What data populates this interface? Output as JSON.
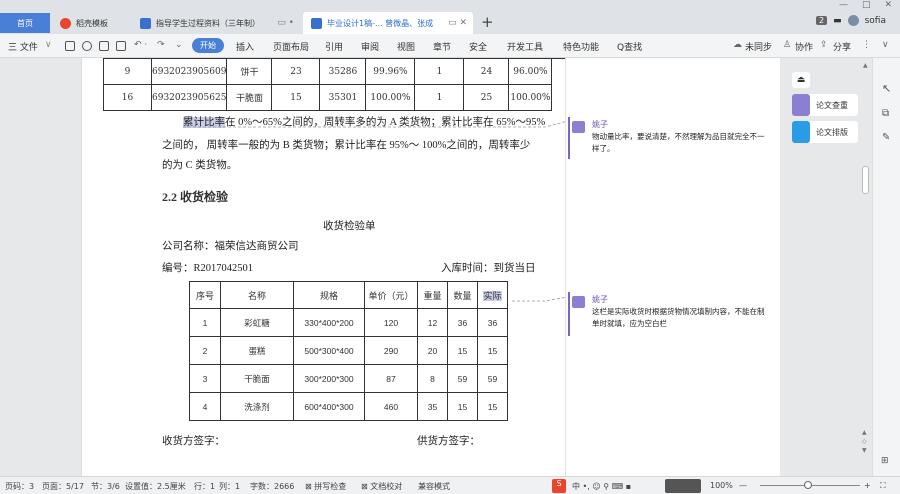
{
  "tabs": [
    {
      "label": "首页"
    },
    {
      "label": "稻壳模板"
    },
    {
      "label": "指导学生过程资料（三年制）"
    },
    {
      "label": "毕业设计1稿-... 曾微晶、张成"
    }
  ],
  "window": {
    "page_count": "2",
    "user": "sofia",
    "minimize": "—",
    "maximize": "□",
    "close": "✕"
  },
  "toolbar": {
    "file": "三 文件",
    "start": "开始",
    "items": [
      "插入",
      "页面布局",
      "引用",
      "审阅",
      "视图",
      "章节",
      "安全",
      "开发工具",
      "特色功能",
      "Q查找"
    ],
    "sync": "未同步",
    "collab": "协作",
    "share": "分享"
  },
  "top_table": {
    "rows": [
      [
        "9",
        "6932023905609",
        "饼干",
        "23",
        "35286",
        "99.96%",
        "1",
        "24",
        "96.00%"
      ],
      [
        "16",
        "6932023905625",
        "干脆面",
        "15",
        "35301",
        "100.00%",
        "1",
        "25",
        "100.00%"
      ]
    ]
  },
  "document": {
    "para1_line1_highlight": "累计比率",
    "para1_line1_rest": "在 0%～65%之间的，周转率多的为 A 类货物；累计比率在 65%～95%",
    "para1_line2": "之间的，  周转率一般的为 B 类货物；累计比率在 95%～ 100%之间的，周转率少",
    "para1_line3": "的为 C 类货物。",
    "heading": "2.2 收货检验",
    "form_title": "收货检验单",
    "company": "公司名称：福荣信达商贸公司",
    "number": "编号：R2017042501",
    "inbound_time": "入库时间：到货当日",
    "receiver_sign": "收货方签字：",
    "supplier_sign": "供货方签字："
  },
  "receipt_table": {
    "headers": [
      "序号",
      "名称",
      "规格",
      "单价（元）",
      "重量",
      "数量",
      "实际"
    ],
    "rows": [
      [
        "1",
        "彩虹糖",
        "330*400*200",
        "120",
        "12",
        "36",
        "36"
      ],
      [
        "2",
        "蛋糕",
        "500*300*400",
        "290",
        "20",
        "15",
        "15"
      ],
      [
        "3",
        "干脆面",
        "300*200*300",
        "87",
        "8",
        "59",
        "59"
      ],
      [
        "4",
        "洗涤剂",
        "600*400*300",
        "460",
        "35",
        "15",
        "15"
      ]
    ]
  },
  "comments": [
    {
      "author": "姚子",
      "text": "物动量比率，要说清楚，不然理解为品目就完全不一样了。"
    },
    {
      "author": "姚子",
      "text": "这栏是实际收货时根据货物情况填制内容，不能在制单时就填，应为空白栏"
    }
  ],
  "right_panel": {
    "check": "论文查重",
    "layout": "论文排版"
  },
  "status": {
    "page_num": "页码：3",
    "page": "页面：5/17",
    "section": "节：3/6",
    "setting": "设置值：2.5厘米",
    "row": "行：1",
    "col": "列：1",
    "words": "字数：2666",
    "spell": "拼写检查",
    "proof": "文档校对",
    "compat": "兼容模式",
    "zoom": "100%"
  },
  "colors": {
    "accent": "#4a7fd8",
    "comment": "#7b64c4"
  }
}
